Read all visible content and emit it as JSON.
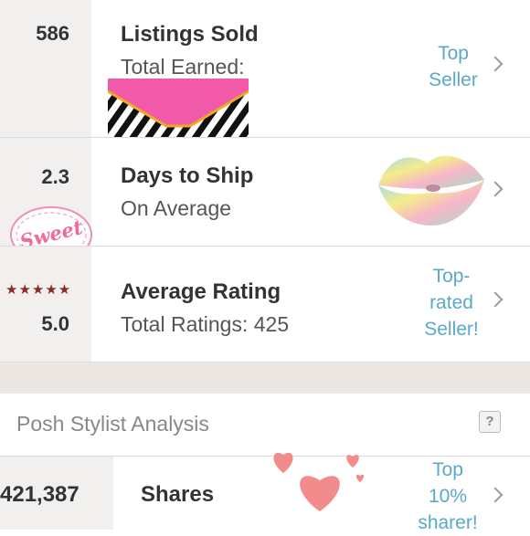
{
  "listings": {
    "count": "586",
    "title": "Listings Sold",
    "subtitle": "Total Earned:",
    "badge_line1": "Top",
    "badge_line2": "Seller"
  },
  "shipping": {
    "value": "2.3",
    "title": "Days to Ship",
    "subtitle": "On Average",
    "sticker_text": "Sweet"
  },
  "rating": {
    "stars": "★★★★★",
    "value": "5.0",
    "title": "Average Rating",
    "subtitle": "Total Ratings: 425",
    "badge_line1": "Top-",
    "badge_line2": "rated",
    "badge_line3": "Seller!"
  },
  "stylist": {
    "heading": "Posh Stylist Analysis",
    "help": "?"
  },
  "shares": {
    "count": "421,387",
    "title": "Shares",
    "badge_line1": "Top",
    "badge_line2": "10%",
    "badge_line3": "sharer!"
  },
  "colors": {
    "accent": "#5aa9c9",
    "pink": "#f05aa8",
    "heart": "#f28b8b"
  }
}
